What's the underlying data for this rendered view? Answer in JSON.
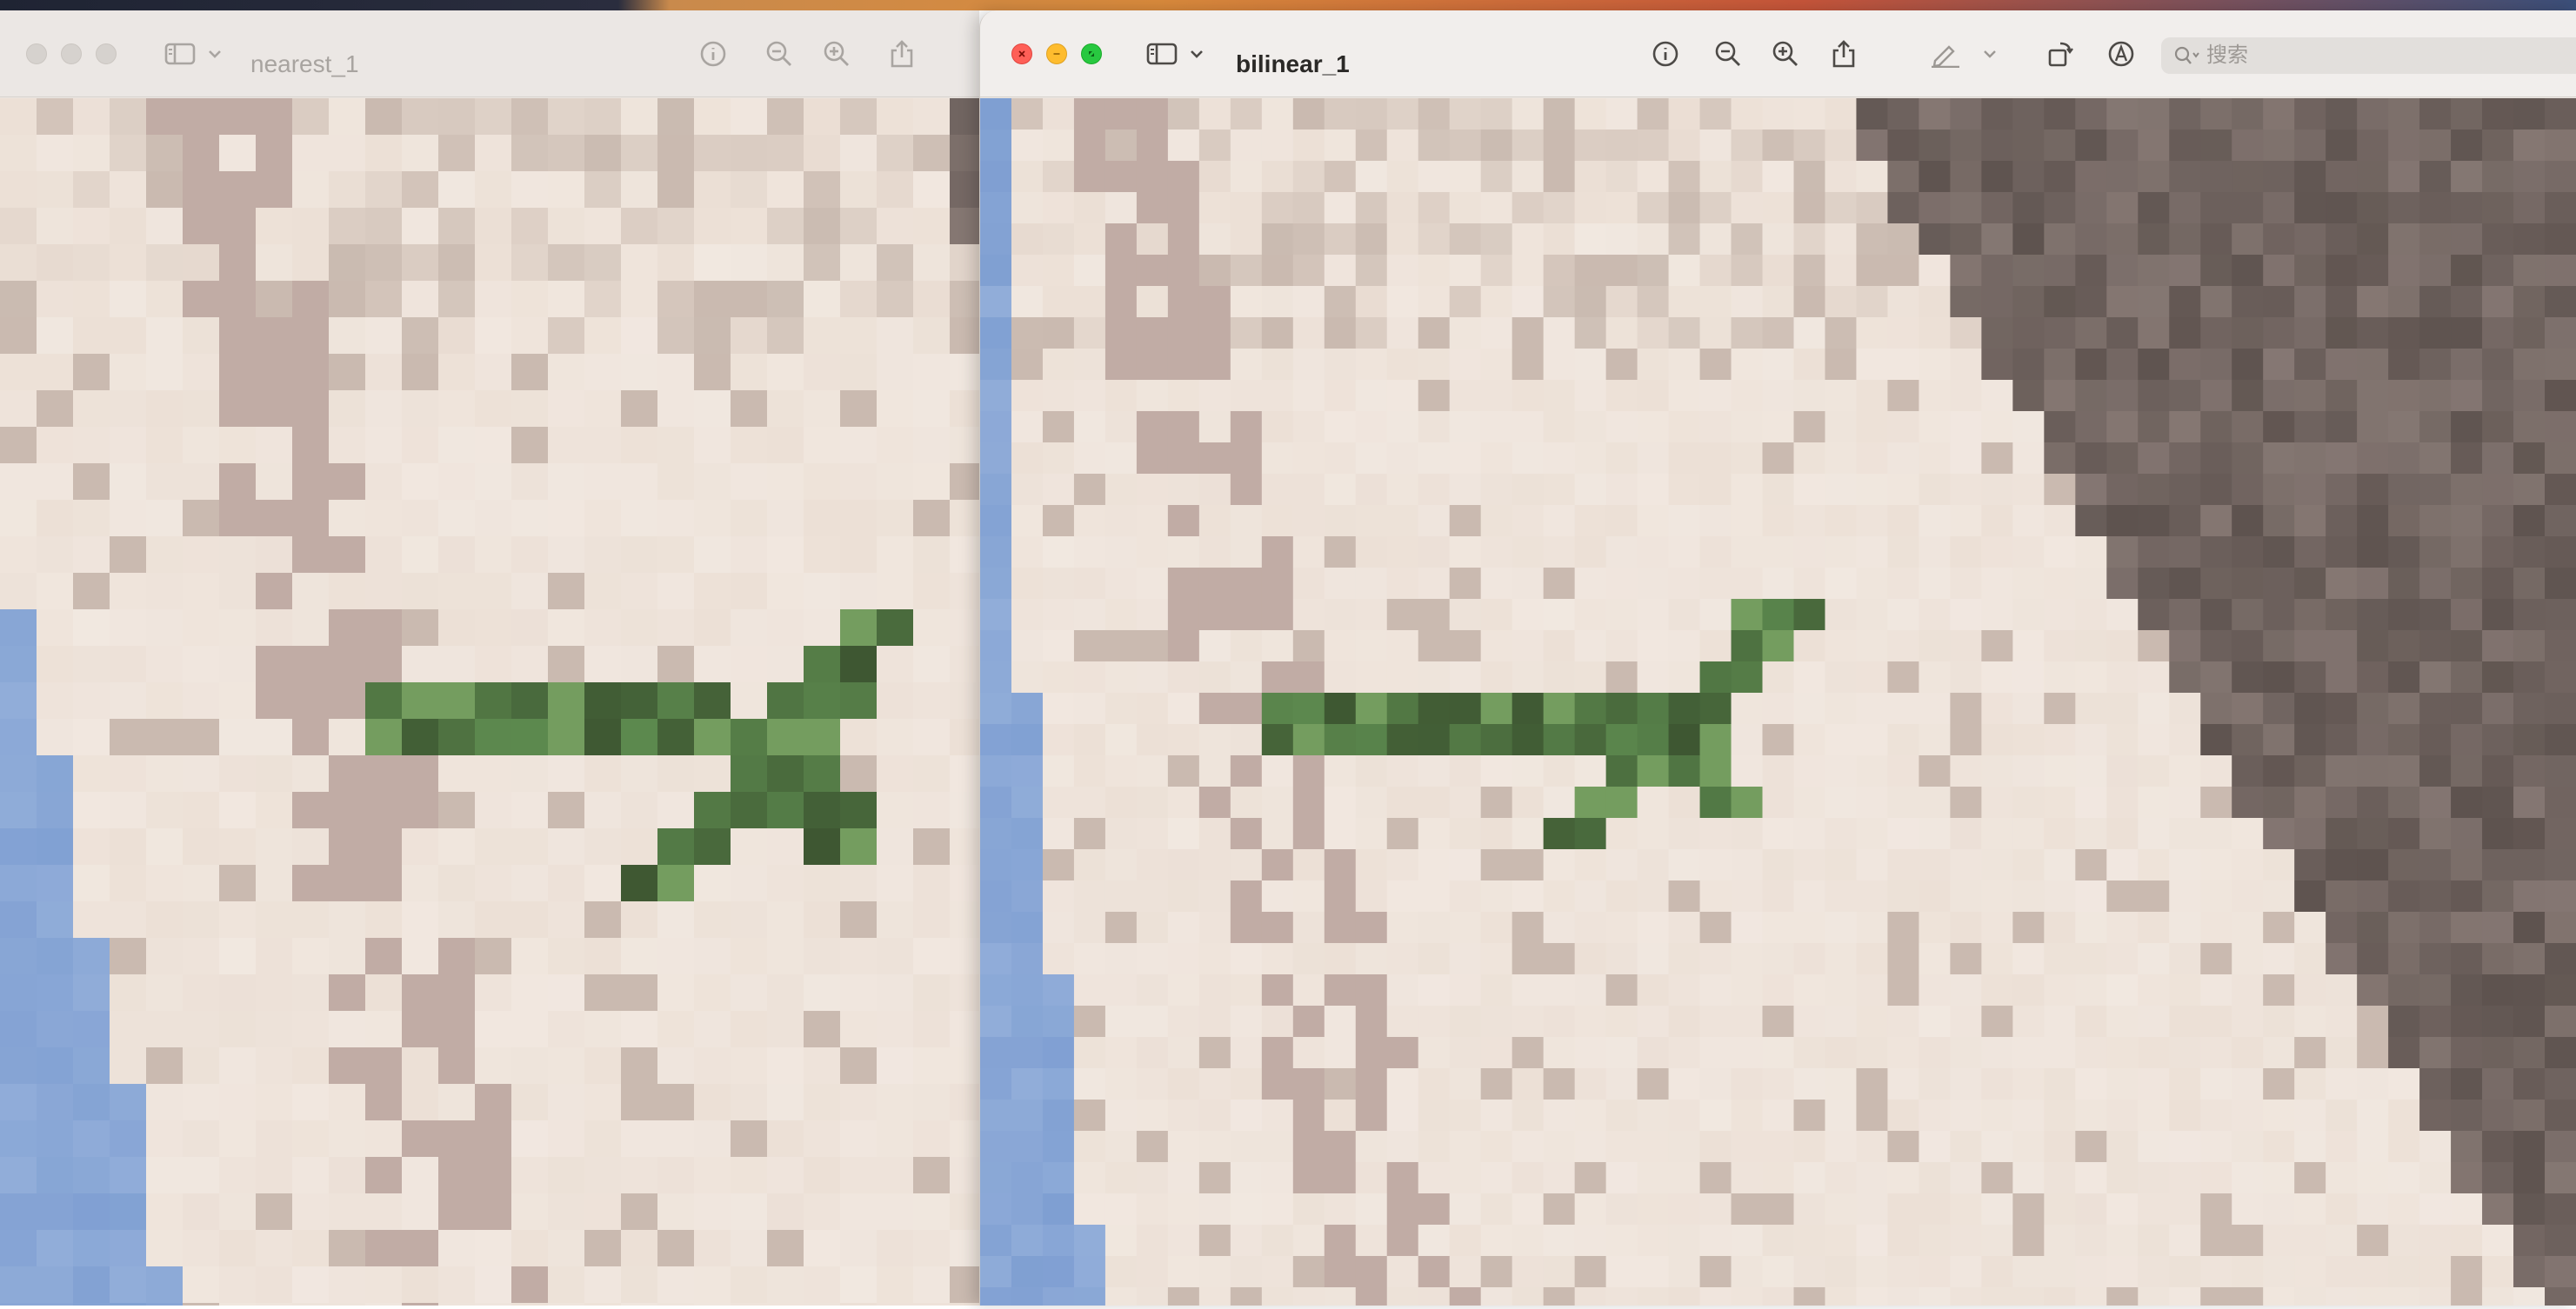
{
  "windows": {
    "left": {
      "title": "nearest_1",
      "state": "inactive",
      "toolbar_icons": [
        "sidebar-icon",
        "chevron-down-icon",
        "info-icon",
        "zoom-out-icon",
        "zoom-in-icon",
        "share-icon"
      ]
    },
    "right": {
      "title": "bilinear_1",
      "state": "active",
      "toolbar_icons": [
        "sidebar-icon",
        "chevron-down-icon",
        "info-icon",
        "zoom-out-icon",
        "zoom-in-icon",
        "share-icon",
        "markup-pen-icon",
        "chevron-down-icon",
        "rotate-icon",
        "annotate-icon"
      ],
      "search": {
        "placeholder": "搜索",
        "value": ""
      }
    }
  },
  "colors": {
    "sky": "#7f9fd2",
    "wall": "#ece0d6",
    "rock_shadow": "#5e534f",
    "plant": "#5d8a4f",
    "close": "#fe5f57",
    "minimize": "#febc2e",
    "zoom": "#28c840"
  }
}
